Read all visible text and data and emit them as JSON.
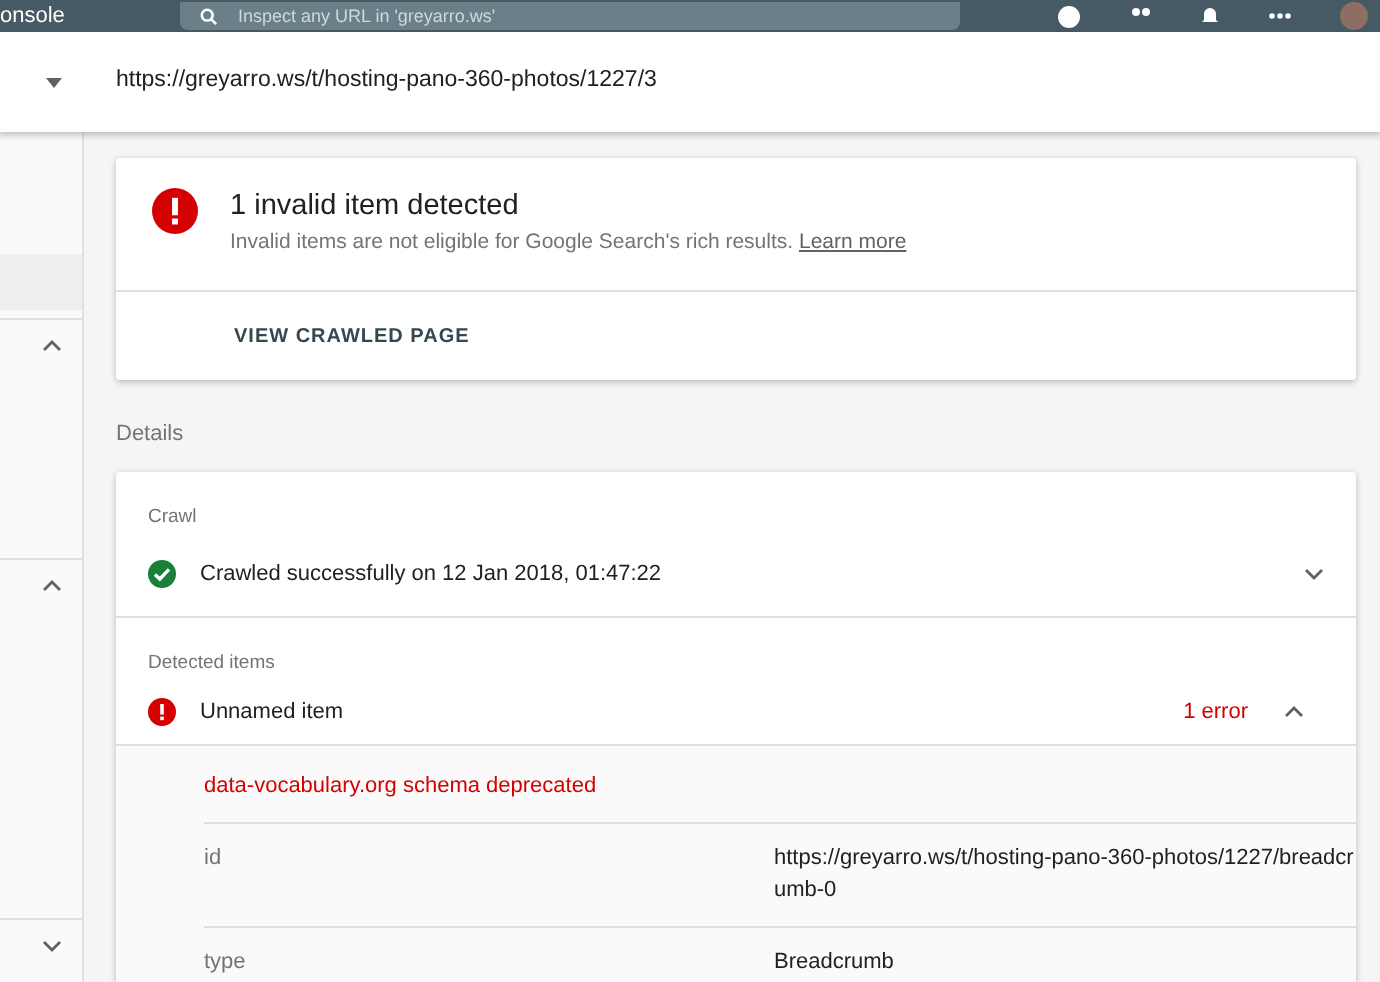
{
  "top_bar": {
    "app_title": "onsole",
    "search": {
      "placeholder": "Inspect any URL in 'greyarro.ws'"
    }
  },
  "url_bar": {
    "url": "https://greyarro.ws/t/hosting-pano-360-photos/1227/3"
  },
  "sidebar": {
    "sections": [
      {
        "expanded": true
      },
      {
        "expanded": true
      },
      {
        "expanded": false
      }
    ]
  },
  "summary": {
    "title": "1 invalid item detected",
    "description": "Invalid items are not eligible for Google Search's rich results.",
    "link": "Learn more",
    "action": "VIEW CRAWLED PAGE"
  },
  "details_heading": "Details",
  "crawl": {
    "heading": "Crawl",
    "kind": "success",
    "text": "Crawled successfully on 12 Jan 2018, 01:47:22",
    "expanded": false
  },
  "detected_items": {
    "heading": "Detected items",
    "items": [
      {
        "kind": "error",
        "name": "Unnamed item",
        "count": "1 error",
        "expanded": true,
        "issue": "data-vocabulary.org schema deprecated",
        "properties": [
          {
            "name": "id",
            "value": "https://greyarro.ws/t/hosting-pano-360-photos/1227/breadcrumb-0"
          },
          {
            "name": "type",
            "value": "Breadcrumb"
          }
        ]
      }
    ]
  }
}
